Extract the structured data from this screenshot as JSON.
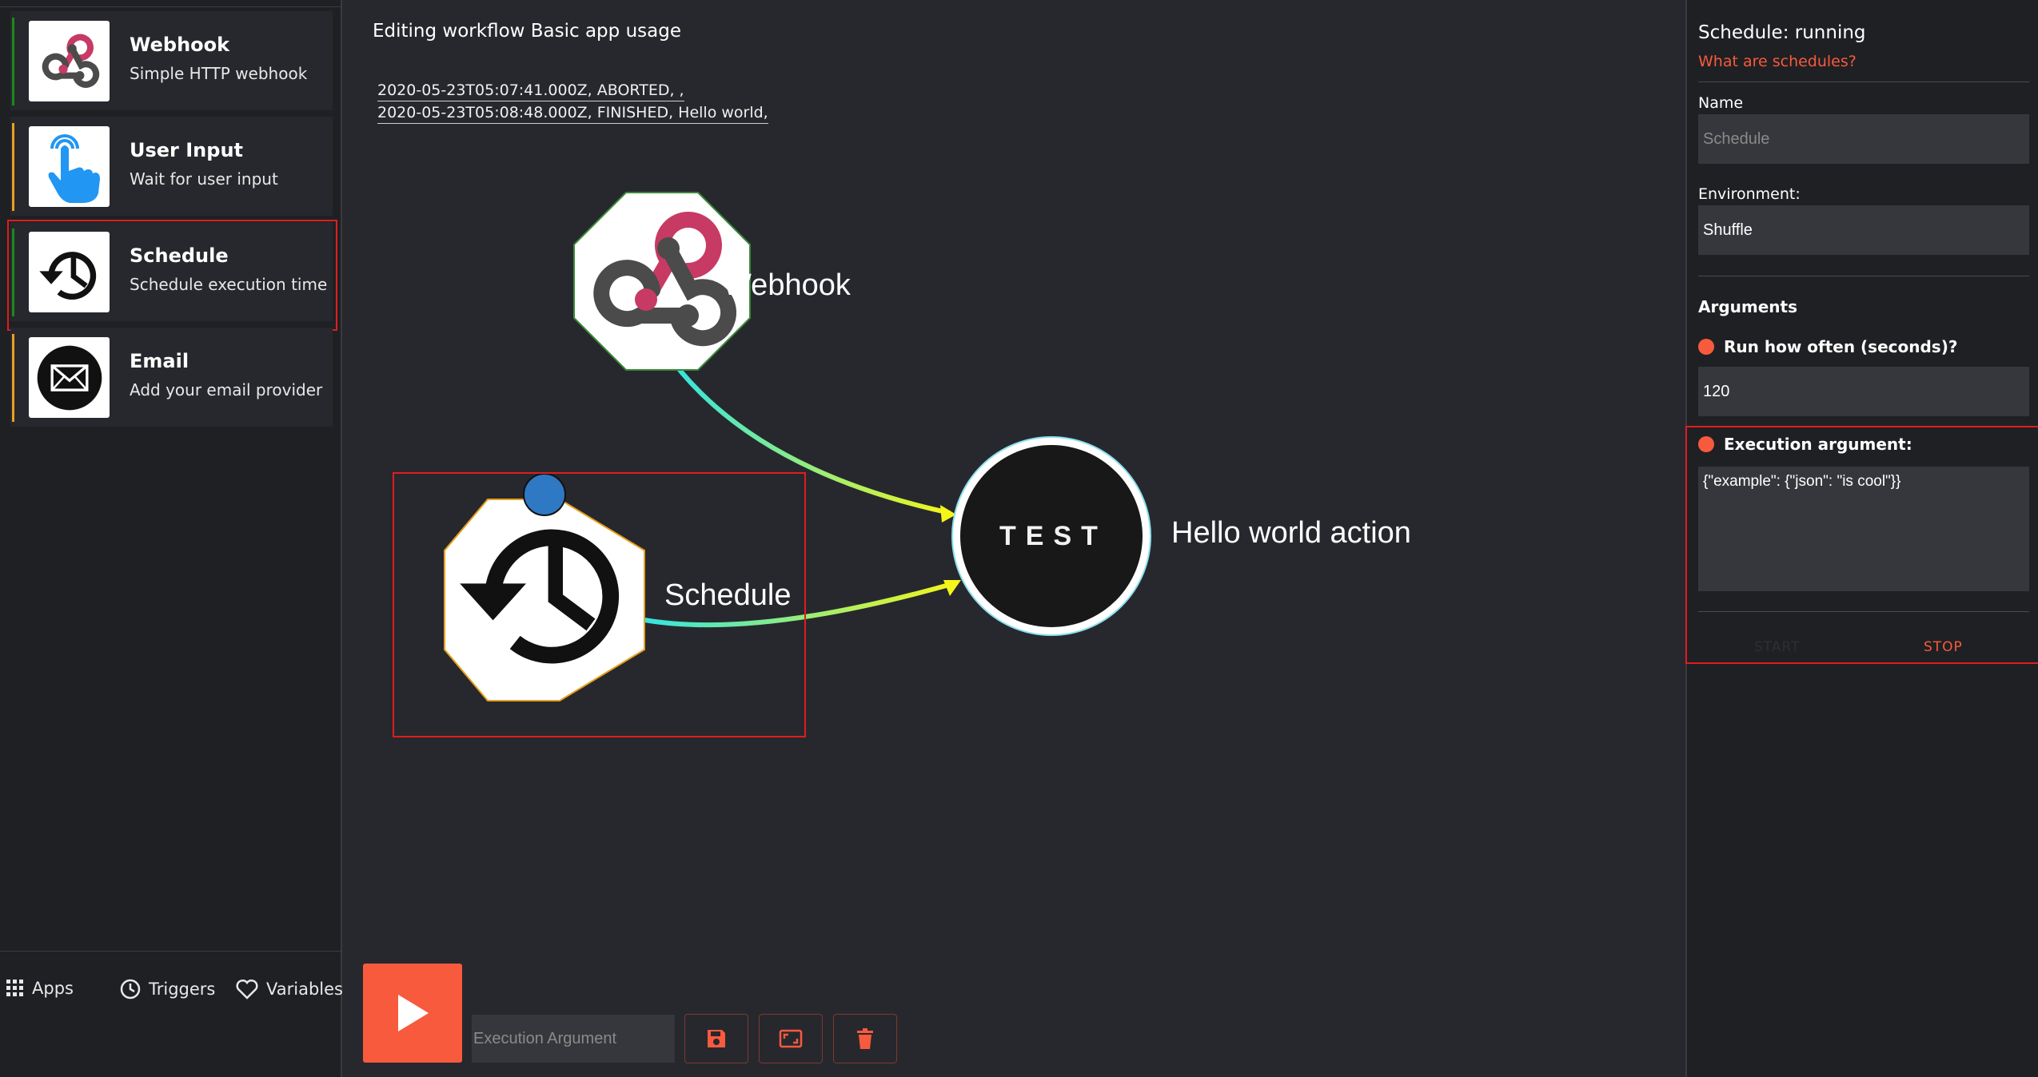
{
  "sidebar": {
    "triggers": [
      {
        "name": "Webhook",
        "description": "Simple HTTP webhook",
        "accent": "#1a8a1a"
      },
      {
        "name": "User Input",
        "description": "Wait for user input",
        "accent": "#e8a020"
      },
      {
        "name": "Schedule",
        "description": "Schedule execution time",
        "accent": "#1a8a1a"
      },
      {
        "name": "Email",
        "description": "Add your email provider",
        "accent": "#e8a020"
      }
    ],
    "nav": {
      "apps": "Apps",
      "triggers": "Triggers",
      "variables": "Variables"
    }
  },
  "canvas": {
    "title": "Editing workflow Basic app usage",
    "executions": [
      "2020-05-23T05:07:41.000Z, ABORTED, ,",
      "2020-05-23T05:08:48.000Z, FINISHED, Hello world,"
    ],
    "nodes": {
      "webhook": {
        "label": "Webhook"
      },
      "schedule": {
        "label": "Schedule"
      },
      "action": {
        "label": "Hello world action",
        "icon_text": "TEST"
      }
    },
    "toolbar": {
      "execution_argument_placeholder": "Execution Argument"
    }
  },
  "panel": {
    "title": "Schedule: running",
    "help_link": "What are schedules?",
    "name_label": "Name",
    "name_placeholder": "Schedule",
    "environment_label": "Environment:",
    "environment_value": "Shuffle",
    "arguments_heading": "Arguments",
    "run_how_often_label": "Run how often (seconds)?",
    "run_how_often_value": "120",
    "execution_argument_label": "Execution argument:",
    "execution_argument_value": "{\"example\": {\"json\": \"is cool\"}}",
    "start_label": "START",
    "stop_label": "STOP"
  },
  "colors": {
    "accent": "#f85a3e",
    "selection": "#e01d1d",
    "background": "#27282d"
  }
}
